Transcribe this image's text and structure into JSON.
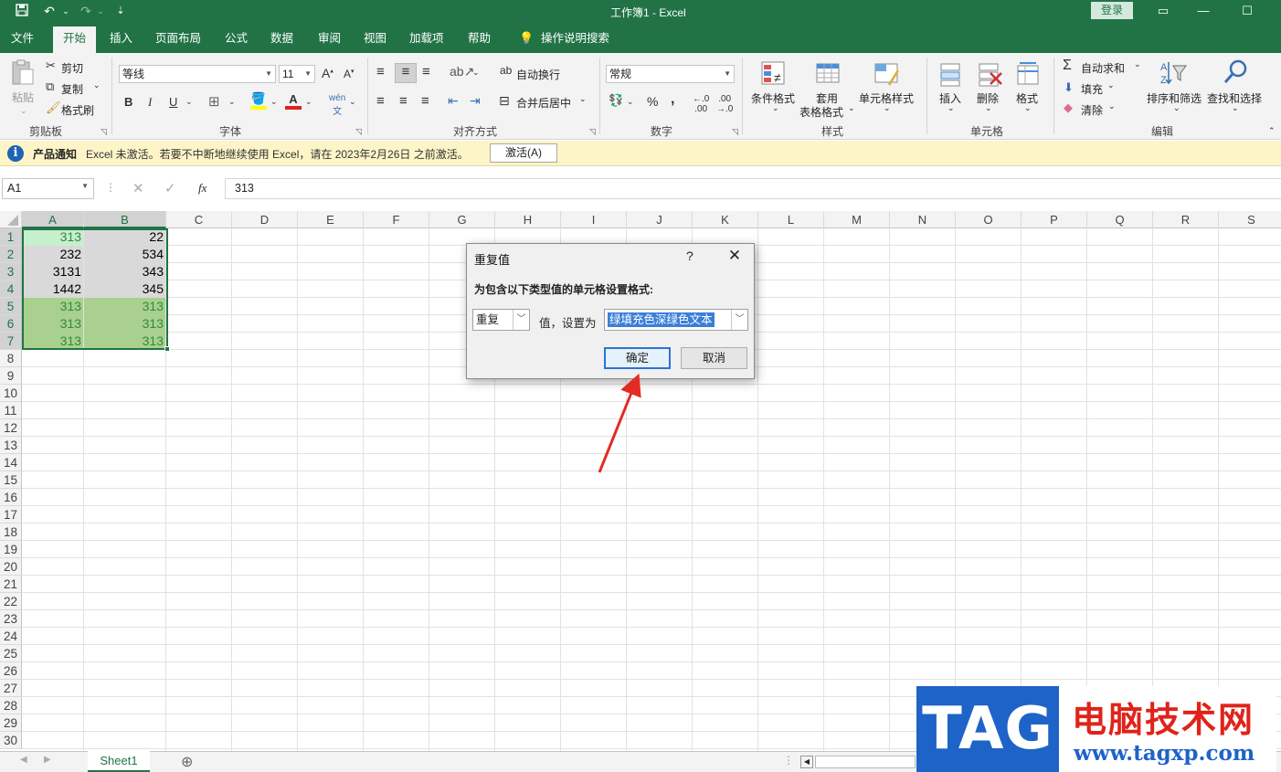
{
  "titlebar": {
    "title": "工作簿1  -  Excel",
    "login": "登录"
  },
  "tabs": [
    "文件",
    "开始",
    "插入",
    "页面布局",
    "公式",
    "数据",
    "审阅",
    "视图",
    "加载项",
    "帮助",
    "操作说明搜索"
  ],
  "ribbon": {
    "clipboard": {
      "paste": "粘贴",
      "cut": "剪切",
      "copy": "复制",
      "format_painter": "格式刷",
      "label": "剪贴板"
    },
    "font": {
      "name": "等线",
      "size": "11",
      "bold": "B",
      "italic": "I",
      "underline": "U",
      "label": "字体"
    },
    "alignment": {
      "wrap": "自动换行",
      "merge": "合并后居中",
      "label": "对齐方式"
    },
    "number": {
      "format": "常规",
      "percent": "%",
      "comma": ",",
      "label": "数字"
    },
    "styles": {
      "conditional": "条件格式",
      "table1": "套用",
      "table2": "表格格式",
      "cell_styles": "单元格样式",
      "label": "样式"
    },
    "cells": {
      "insert": "插入",
      "delete": "删除",
      "format": "格式",
      "label": "单元格"
    },
    "editing": {
      "autosum": "自动求和",
      "fill": "填充",
      "clear": "清除",
      "sort_filter": "排序和筛选",
      "find_select": "查找和选择",
      "label": "编辑"
    }
  },
  "notice": {
    "title": "产品通知",
    "message": "Excel 未激活。若要不中断地继续使用 Excel，请在 2023年2月26日 之前激活。",
    "button": "激活(A)"
  },
  "formula_bar": {
    "name_box": "A1",
    "fx": "fx",
    "value": "313"
  },
  "columns": [
    "A",
    "B",
    "C",
    "D",
    "E",
    "F",
    "G",
    "H",
    "I",
    "J",
    "K",
    "L",
    "M",
    "N",
    "O",
    "P",
    "Q",
    "R",
    "S"
  ],
  "rows": [
    "1",
    "2",
    "3",
    "4",
    "5",
    "6",
    "7",
    "8",
    "9",
    "10",
    "11",
    "12",
    "13",
    "14",
    "15",
    "16",
    "17",
    "18",
    "19",
    "20",
    "21",
    "22",
    "23",
    "24",
    "25",
    "26",
    "27",
    "28",
    "29",
    "30"
  ],
  "cells": {
    "A": [
      "313",
      "232",
      "3131",
      "1442",
      "313",
      "313",
      "313"
    ],
    "B": [
      "22",
      "534",
      "343",
      "345",
      "313",
      "313",
      "313"
    ]
  },
  "highlight": {
    "green_fill": "#a9d08e",
    "green_text": "#2e8b3e",
    "gray_fill": "#d9d9d9",
    "light_green_fill": "#c6efce"
  },
  "sheet": {
    "tab": "Sheet1"
  },
  "dialog": {
    "title": "重复值",
    "help": "?",
    "prompt": "为包含以下类型值的单元格设置格式:",
    "type_value": "重复",
    "mid_text": "值，设置为",
    "format_value": "绿填充色深绿色文本",
    "ok": "确定",
    "cancel": "取消"
  },
  "watermark": {
    "tag": "TAG",
    "cn": "电脑技术网",
    "url": "www.tagxp.com"
  }
}
